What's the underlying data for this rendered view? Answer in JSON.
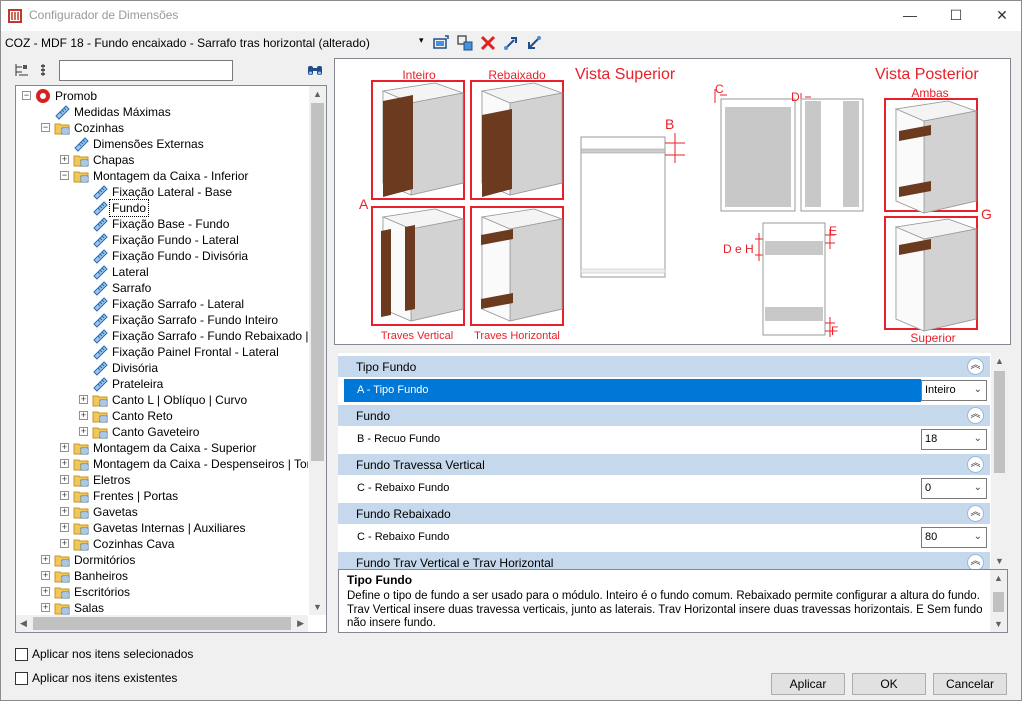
{
  "window": {
    "title": "Configurador de Dimensões",
    "minimize": "—",
    "maximize": "☐",
    "close": "✕"
  },
  "toolbar": {
    "config_name": "COZ - MDF 18 - Fundo encaixado - Sarrafo tras horizontal (alterado)",
    "dropdown_arrow": "▾"
  },
  "tree": {
    "search_value": "",
    "items": [
      {
        "label": "Promob",
        "level": 0,
        "expand": "−",
        "icon": "promob-logo-icon"
      },
      {
        "label": "Medidas Máximas",
        "level": 1,
        "expand": "",
        "icon": "ruler-icon"
      },
      {
        "label": "Cozinhas",
        "level": 1,
        "expand": "−",
        "icon": "folder-icon"
      },
      {
        "label": "Dimensões Externas",
        "level": 2,
        "expand": "",
        "icon": "ruler-icon"
      },
      {
        "label": "Chapas",
        "level": 2,
        "expand": "+",
        "icon": "folder-icon"
      },
      {
        "label": "Montagem da Caixa - Inferior",
        "level": 2,
        "expand": "−",
        "icon": "folder-icon"
      },
      {
        "label": "Fixação Lateral - Base",
        "level": 3,
        "expand": "",
        "icon": "ruler-icon"
      },
      {
        "label": "Fundo",
        "level": 3,
        "expand": "",
        "icon": "ruler-icon",
        "selected": true
      },
      {
        "label": "Fixação Base - Fundo",
        "level": 3,
        "expand": "",
        "icon": "ruler-icon"
      },
      {
        "label": "Fixação Fundo - Lateral",
        "level": 3,
        "expand": "",
        "icon": "ruler-icon"
      },
      {
        "label": "Fixação Fundo - Divisória",
        "level": 3,
        "expand": "",
        "icon": "ruler-icon"
      },
      {
        "label": "Lateral",
        "level": 3,
        "expand": "",
        "icon": "ruler-icon"
      },
      {
        "label": "Sarrafo",
        "level": 3,
        "expand": "",
        "icon": "ruler-icon"
      },
      {
        "label": "Fixação Sarrafo - Lateral",
        "level": 3,
        "expand": "",
        "icon": "ruler-icon"
      },
      {
        "label": "Fixação Sarrafo - Fundo Inteiro",
        "level": 3,
        "expand": "",
        "icon": "ruler-icon"
      },
      {
        "label": "Fixação Sarrafo - Fundo Rebaixado | Tra",
        "level": 3,
        "expand": "",
        "icon": "ruler-icon"
      },
      {
        "label": "Fixação Painel Frontal - Lateral",
        "level": 3,
        "expand": "",
        "icon": "ruler-icon"
      },
      {
        "label": "Divisória",
        "level": 3,
        "expand": "",
        "icon": "ruler-icon"
      },
      {
        "label": "Prateleira",
        "level": 3,
        "expand": "",
        "icon": "ruler-icon"
      },
      {
        "label": "Canto L | Oblíquo | Curvo",
        "level": 3,
        "expand": "+",
        "icon": "folder-icon"
      },
      {
        "label": "Canto Reto",
        "level": 3,
        "expand": "+",
        "icon": "folder-icon"
      },
      {
        "label": "Canto Gaveteiro",
        "level": 3,
        "expand": "+",
        "icon": "folder-icon"
      },
      {
        "label": "Montagem da Caixa - Superior",
        "level": 2,
        "expand": "+",
        "icon": "folder-icon"
      },
      {
        "label": "Montagem da Caixa - Despenseiros | Torres",
        "level": 2,
        "expand": "+",
        "icon": "folder-icon"
      },
      {
        "label": "Eletros",
        "level": 2,
        "expand": "+",
        "icon": "folder-icon"
      },
      {
        "label": "Frentes | Portas",
        "level": 2,
        "expand": "+",
        "icon": "folder-icon"
      },
      {
        "label": "Gavetas",
        "level": 2,
        "expand": "+",
        "icon": "folder-icon"
      },
      {
        "label": "Gavetas Internas | Auxiliares",
        "level": 2,
        "expand": "+",
        "icon": "folder-icon"
      },
      {
        "label": "Cozinhas Cava",
        "level": 2,
        "expand": "+",
        "icon": "folder-icon"
      },
      {
        "label": "Dormitórios",
        "level": 1,
        "expand": "+",
        "icon": "folder-icon"
      },
      {
        "label": "Banheiros",
        "level": 1,
        "expand": "+",
        "icon": "folder-icon"
      },
      {
        "label": "Escritórios",
        "level": 1,
        "expand": "+",
        "icon": "folder-icon"
      },
      {
        "label": "Salas",
        "level": 1,
        "expand": "+",
        "icon": "folder-icon"
      }
    ]
  },
  "preview": {
    "labels": {
      "inteiro": "Inteiro",
      "rebaixado": "Rebaixado",
      "vista_superior": "Vista Superior",
      "vista_posterior": "Vista Posterior",
      "ambas": "Ambas",
      "a": "A",
      "b": "B",
      "c": "C",
      "d": "D",
      "e": "E",
      "f": "F",
      "g": "G",
      "d_e_h": "D e H",
      "traves_vertical": "Traves Vertical",
      "traves_horizontal": "Traves Horizontal",
      "superior": "Superior"
    },
    "accent": "#e8202a",
    "wood": "#6b3a1f"
  },
  "properties": {
    "categories": [
      {
        "title": "Tipo Fundo",
        "rows": [
          {
            "name": "A - Tipo Fundo",
            "value": "Inteiro",
            "selected": true
          }
        ]
      },
      {
        "title": "Fundo",
        "rows": [
          {
            "name": "B - Recuo Fundo",
            "value": "18"
          }
        ]
      },
      {
        "title": "Fundo Travessa Vertical",
        "rows": [
          {
            "name": "C - Rebaixo Fundo",
            "value": "0"
          }
        ]
      },
      {
        "title": "Fundo Rebaixado",
        "rows": [
          {
            "name": "C - Rebaixo Fundo",
            "value": "80"
          }
        ]
      },
      {
        "title": "Fundo Trav Vertical e Trav Horizontal",
        "rows": []
      }
    ],
    "collapse_glyph": "︽"
  },
  "description": {
    "title": "Tipo Fundo",
    "text": "Define o tipo de fundo a ser usado para o módulo. Inteiro é o fundo comum. Rebaixado permite configurar a altura do fundo. Trav Vertical insere duas travessa verticais, junto as laterais. Trav Horizontal insere duas travessas horizontais. E Sem fundo não insere fundo."
  },
  "options": {
    "apply_selected": "Aplicar nos itens selecionados",
    "apply_existing": "Aplicar nos itens existentes"
  },
  "buttons": {
    "apply": "Aplicar",
    "ok": "OK",
    "cancel": "Cancelar"
  }
}
